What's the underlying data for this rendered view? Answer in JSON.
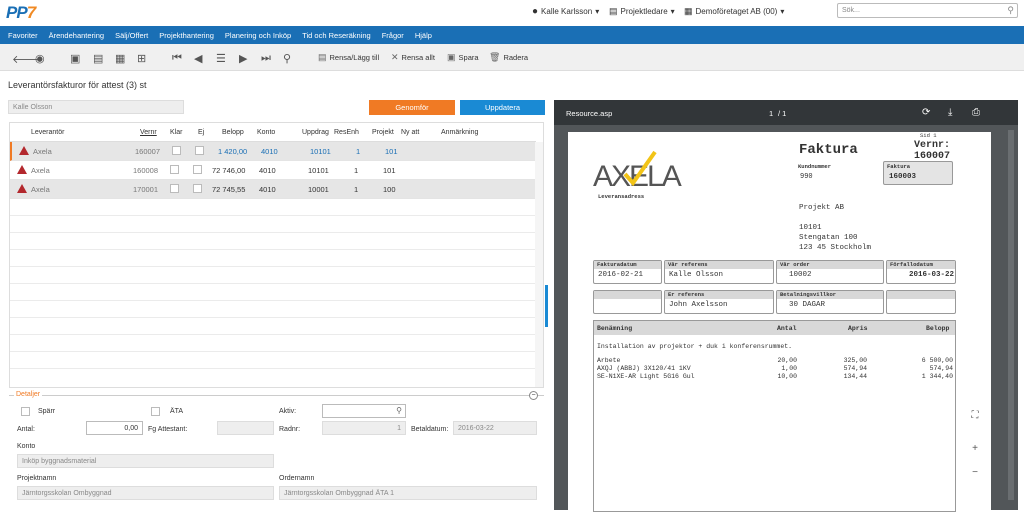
{
  "app": {
    "logo": "PP",
    "logo_accent": "7"
  },
  "topbar": {
    "user": "Kalle Karlsson",
    "role": "Projektledare",
    "company": "Demoföretaget AB (00)",
    "search_placeholder": "Sök..."
  },
  "nav": [
    "Favoriter",
    "Ärendehantering",
    "Sälj/Offert",
    "Projekthantering",
    "Planering och Inköp",
    "Tid och Reseräkning",
    "Frågor",
    "Hjälp"
  ],
  "toolbar": {
    "clear_add": "Rensa/Lägg till",
    "clear_all": "Rensa allt",
    "save": "Spara",
    "delete": "Radera"
  },
  "page_title": "Leverantörsfakturor för attest (3) st",
  "filter": {
    "user": "Kalle Olsson",
    "execute": "Genomför",
    "update": "Uppdatera"
  },
  "grid": {
    "headers": [
      "Leverantör",
      "Vernr",
      "Klar",
      "Ej",
      "Belopp",
      "Konto",
      "Uppdrag",
      "ResEnh",
      "Projekt",
      "Ny att",
      "Anmärkning"
    ],
    "rows": [
      {
        "supplier": "Axela",
        "vernr": "160007",
        "amount": "1 420,00",
        "account": "4010",
        "assignment": "10101",
        "resenh": "1",
        "project": "101"
      },
      {
        "supplier": "Axela",
        "vernr": "160008",
        "amount": "72 746,00",
        "account": "4010",
        "assignment": "10101",
        "resenh": "1",
        "project": "101"
      },
      {
        "supplier": "Axela",
        "vernr": "170001",
        "amount": "72 745,55",
        "account": "4010",
        "assignment": "10001",
        "resenh": "1",
        "project": "100"
      }
    ]
  },
  "details": {
    "title": "Detaljer",
    "sparr": "Spärr",
    "ata": "ÄTA",
    "aktiv": "Aktiv:",
    "antal_label": "Antal:",
    "antal_value": "0,00",
    "fg_attestant": "Fg Attestant:",
    "radnr_label": "Radnr:",
    "radnr_value": "1",
    "betaldatum_label": "Betaldatum:",
    "betaldatum_value": "2016-03-22",
    "konto_label": "Konto",
    "konto_value": "Inköp byggnadsmaterial",
    "projektnamn_label": "Projektnamn",
    "projektnamn_value": "Järntorgsskolan Ombyggnad",
    "ordernamn_label": "Ordernamn",
    "ordernamn_value": "Järntorgsskolan Ombyggnad ÄTA 1"
  },
  "pdf": {
    "filename": "Resource.asp",
    "page": "1",
    "page_total": "/ 1",
    "sid": "Sid 1",
    "title": "Faktura",
    "vernr": "Vernr: 160007",
    "kundnummer_label": "Kundnummer",
    "kundnummer": "990",
    "faktura_label": "Faktura",
    "faktura_value": "160003",
    "logo": "AXELA",
    "leveransadress": "Leveransadress",
    "addr1": "Projekt AB",
    "addr2": "10101",
    "addr3": "Stengatan 100",
    "addr4": "123 45 Stockholm",
    "fakturadatum_label": "Fakturadatum",
    "fakturadatum": "2016-02-21",
    "var_ref_label": "Vår referens",
    "var_ref": "Kalle Olsson",
    "var_order_label": "Vår order",
    "var_order": "10002",
    "forfallodatum_label": "Förfallodatum",
    "forfallodatum": "2016-03-22",
    "er_ref_label": "Er referens",
    "er_ref": "John Axelsson",
    "betvillkor_label": "Betalningsvillkor",
    "betvillkor": "30 DAGAR",
    "cols": [
      "Benämning",
      "Antal",
      "Apris",
      "Belopp"
    ],
    "note": "Installation av projektor + duk i konferensrummet.",
    "lines": [
      {
        "name": "Arbete",
        "qty": "20,00",
        "price": "325,00",
        "amount": "6 500,00"
      },
      {
        "name": "AXQJ (ABBJ) 3X120/41 1KV",
        "qty": "1,00",
        "price": "574,94",
        "amount": "574,94"
      },
      {
        "name": "SE-N1XE-AR Light 5G16 Gul",
        "qty": "10,00",
        "price": "134,44",
        "amount": "1 344,40"
      }
    ]
  },
  "colors": {
    "nav": "#1a6fb5",
    "orange": "#f07a24",
    "blue": "#1a8ad4",
    "warning": "#b3282d",
    "link": "#1a6fb5"
  }
}
